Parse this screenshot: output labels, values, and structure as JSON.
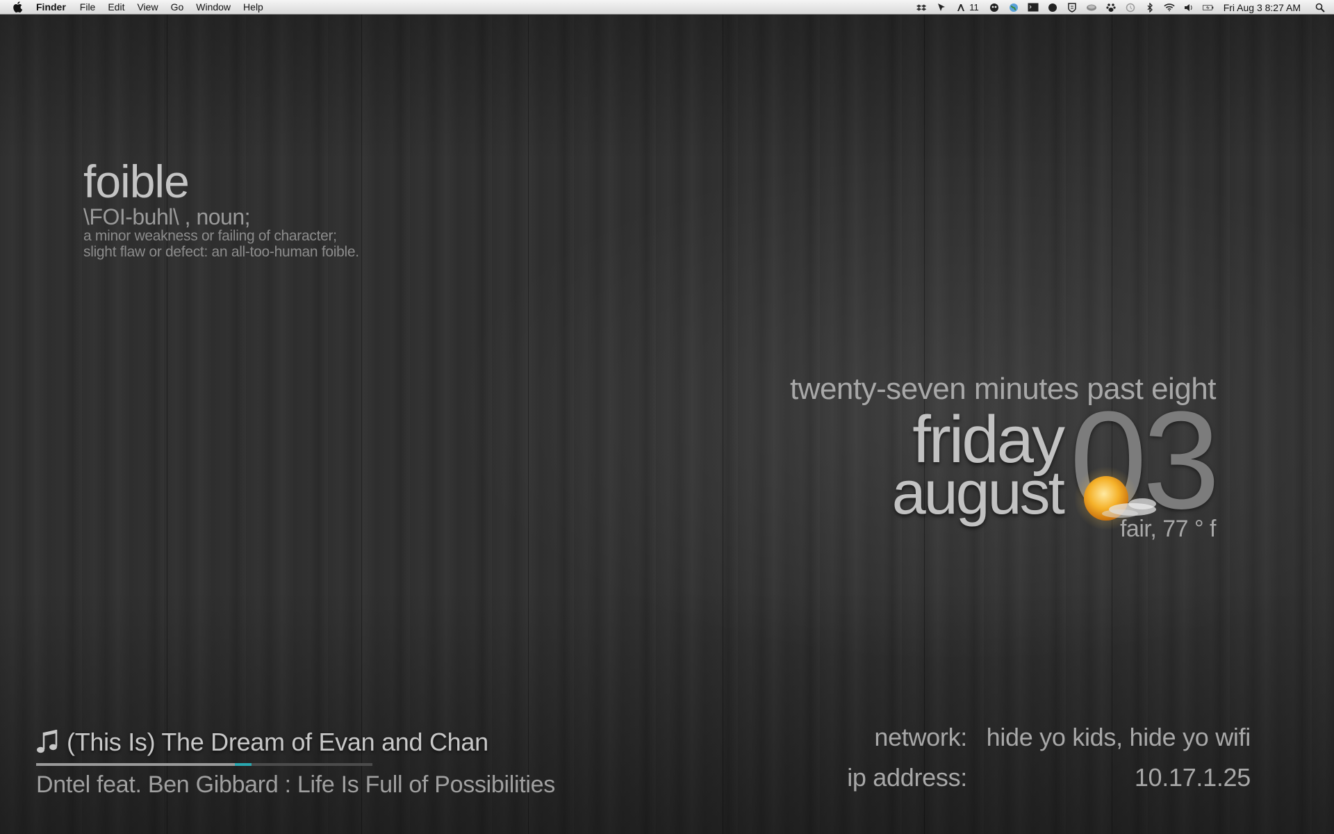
{
  "menubar": {
    "app_name": "Finder",
    "menus": [
      "File",
      "Edit",
      "View",
      "Go",
      "Window",
      "Help"
    ],
    "status_icons": [
      "dropbox-icon",
      "cursor-icon",
      "adobe-icon",
      "alien-icon",
      "globe-icon",
      "terminal-icon",
      "record-icon",
      "shield-icon",
      "disk-icon",
      "paw-icon",
      "time-machine-icon",
      "bluetooth-icon",
      "wifi-icon",
      "volume-icon",
      "battery-icon",
      "spotlight-icon"
    ],
    "adobe_count": "11",
    "clock": "Fri Aug 3  8:27 AM"
  },
  "word_of_day": {
    "word": "foible",
    "pronunciation": "\\FOI-buhl\\ , noun;",
    "definition_line1": "a minor weakness or failing of character;",
    "definition_line2": "slight flaw or defect: an all-too-human foible."
  },
  "clock": {
    "time_words": "twenty-seven minutes past eight",
    "weekday": "friday",
    "month": "august",
    "day": "03"
  },
  "weather": {
    "icon": "sun-with-cloud-icon",
    "text": "fair, 77 ° f"
  },
  "now_playing": {
    "track": "(This Is) The Dream of Evan and Chan",
    "artist_album": "Dntel feat. Ben Gibbard : Life Is Full of Possibilities",
    "progress": 0.64
  },
  "network": {
    "network_label": "network:",
    "network_value": "hide yo kids, hide yo wifi",
    "ip_label": "ip address:",
    "ip_value": "10.17.1.25"
  },
  "colors": {
    "accent": "#2aa8b0",
    "text_light": "#c2c2c2",
    "text_dim": "#8c8c8c"
  }
}
